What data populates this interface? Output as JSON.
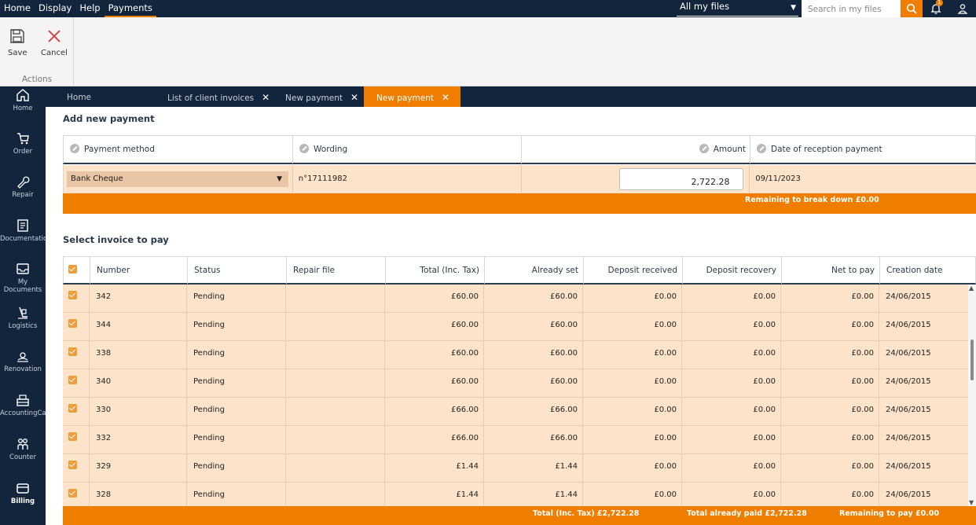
{
  "menu": [
    "Home",
    "Display",
    "Help",
    "Payments"
  ],
  "active_menu": "Payments",
  "file_filter": "All my files",
  "search_placeholder": "Search in my files",
  "notification_count": "1",
  "ribbon": {
    "save": "Save",
    "cancel": "Cancel",
    "group": "Actions"
  },
  "sidebar": [
    "Home",
    "Order",
    "Repair",
    "Documentation",
    "My Documents",
    "Logistics",
    "Renovation",
    "AccountingCash",
    "Counter",
    "Billing"
  ],
  "tabs": [
    "Home",
    "List of client invoices",
    "New payment",
    "New payment"
  ],
  "add_payment": {
    "title": "Add new payment",
    "headers": {
      "method": "Payment method",
      "wording": "Wording",
      "amount": "Amount",
      "date": "Date of reception payment"
    },
    "method": "Bank Cheque",
    "wording": "n°17111982",
    "amount": "2,722.28",
    "date": "09/11/2023",
    "remaining": "Remaining to break down £0.00"
  },
  "invoices": {
    "title": "Select invoice to pay",
    "headers": [
      "Number",
      "Status",
      "Repair file",
      "Total (Inc. Tax)",
      "Already set",
      "Deposit received",
      "Deposit recovery",
      "Net to pay",
      "Creation date"
    ],
    "rows": [
      [
        "342",
        "Pending",
        "",
        "£60.00",
        "£60.00",
        "£0.00",
        "£0.00",
        "£0.00",
        "24/06/2015"
      ],
      [
        "344",
        "Pending",
        "",
        "£60.00",
        "£60.00",
        "£0.00",
        "£0.00",
        "£0.00",
        "24/06/2015"
      ],
      [
        "338",
        "Pending",
        "",
        "£60.00",
        "£60.00",
        "£0.00",
        "£0.00",
        "£0.00",
        "24/06/2015"
      ],
      [
        "340",
        "Pending",
        "",
        "£60.00",
        "£60.00",
        "£0.00",
        "£0.00",
        "£0.00",
        "24/06/2015"
      ],
      [
        "330",
        "Pending",
        "",
        "£66.00",
        "£66.00",
        "£0.00",
        "£0.00",
        "£0.00",
        "24/06/2015"
      ],
      [
        "332",
        "Pending",
        "",
        "£66.00",
        "£66.00",
        "£0.00",
        "£0.00",
        "£0.00",
        "24/06/2015"
      ],
      [
        "329",
        "Pending",
        "",
        "£1.44",
        "£1.44",
        "£0.00",
        "£0.00",
        "£0.00",
        "24/06/2015"
      ],
      [
        "328",
        "Pending",
        "",
        "£1.44",
        "£1.44",
        "£0.00",
        "£0.00",
        "£0.00",
        "24/06/2015"
      ]
    ],
    "totals": {
      "total": "Total (Inc. Tax) £2,722.28",
      "paid": "Total already paid £2,722.28",
      "remaining": "Remaining to pay £0.00"
    }
  }
}
